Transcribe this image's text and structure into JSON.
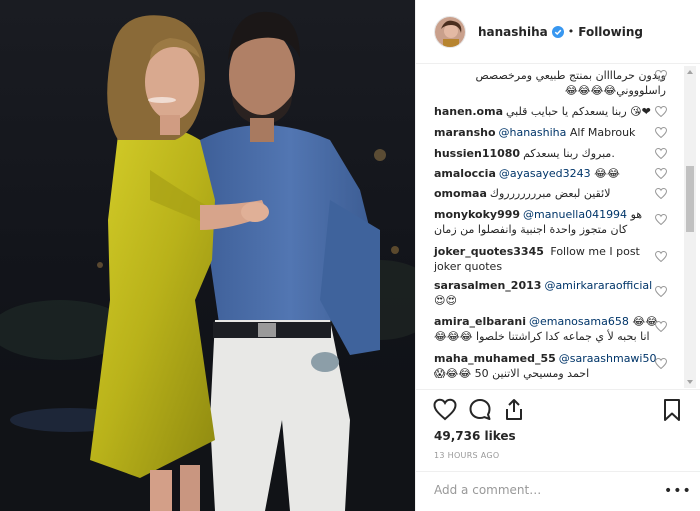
{
  "post": {
    "username": "hanashiha",
    "follow_status": "Following",
    "dot": "•",
    "likes": "49,736 likes",
    "time": "13 HOURS AGO",
    "comment_placeholder": "Add a comment…",
    "more_glyph": "•••"
  },
  "comments": [
    {
      "user": "",
      "text": "ويدون حرماااان بمنتج طبيعي ومرخصصص ",
      "text2": "راسلوووني😂😂😂😂",
      "rtl": true
    },
    {
      "user": "hanen.oma",
      "text": "ربنا يسعدكم يا حبايب قلبي 😘❤"
    },
    {
      "user": "maransho",
      "mention": "@hanashiha",
      "text": " Alf Mabrouk"
    },
    {
      "user": "hussien11080",
      "text": "مبروك ربنا يسعدكم."
    },
    {
      "user": "amaloccia",
      "mention": "@ayasayed3243",
      "text": " 😂😂"
    },
    {
      "user": "omomaa",
      "text": "لائقين لبعض مبررررررروك"
    },
    {
      "user": "monykoky999",
      "mention": "@manuella041994",
      "text": " هو",
      "text2": "كان متجوز واحدة اجنبية وانفصلوا من زمان"
    },
    {
      "user": "joker_quotes3345",
      "text": " Follow me I post",
      "text2": "joker quotes"
    },
    {
      "user": "sarasalmen_2013",
      "mention": "@amirkararaofficial",
      "text": "",
      "text2": "😍😍"
    },
    {
      "user": "amira_elbarani",
      "mention": "@emanosama658",
      "text": " 😂😂",
      "text2": "انا بحبه لأ ي جماعه كدا كراشتنا خلصوا 😂😂😂"
    },
    {
      "user": "maha_muhamed_55",
      "mention": "@saraashmawi50",
      "text": "",
      "text2": "احمد ومسيحي الاتنين 50 😂😂😱"
    }
  ],
  "colors": {
    "verified": "#3897f0",
    "dress": "#c8c21a",
    "shirt": "#4a6ea8"
  },
  "icons": [
    "heart-icon",
    "comment-icon",
    "share-icon",
    "bookmark-icon",
    "verified-icon"
  ]
}
